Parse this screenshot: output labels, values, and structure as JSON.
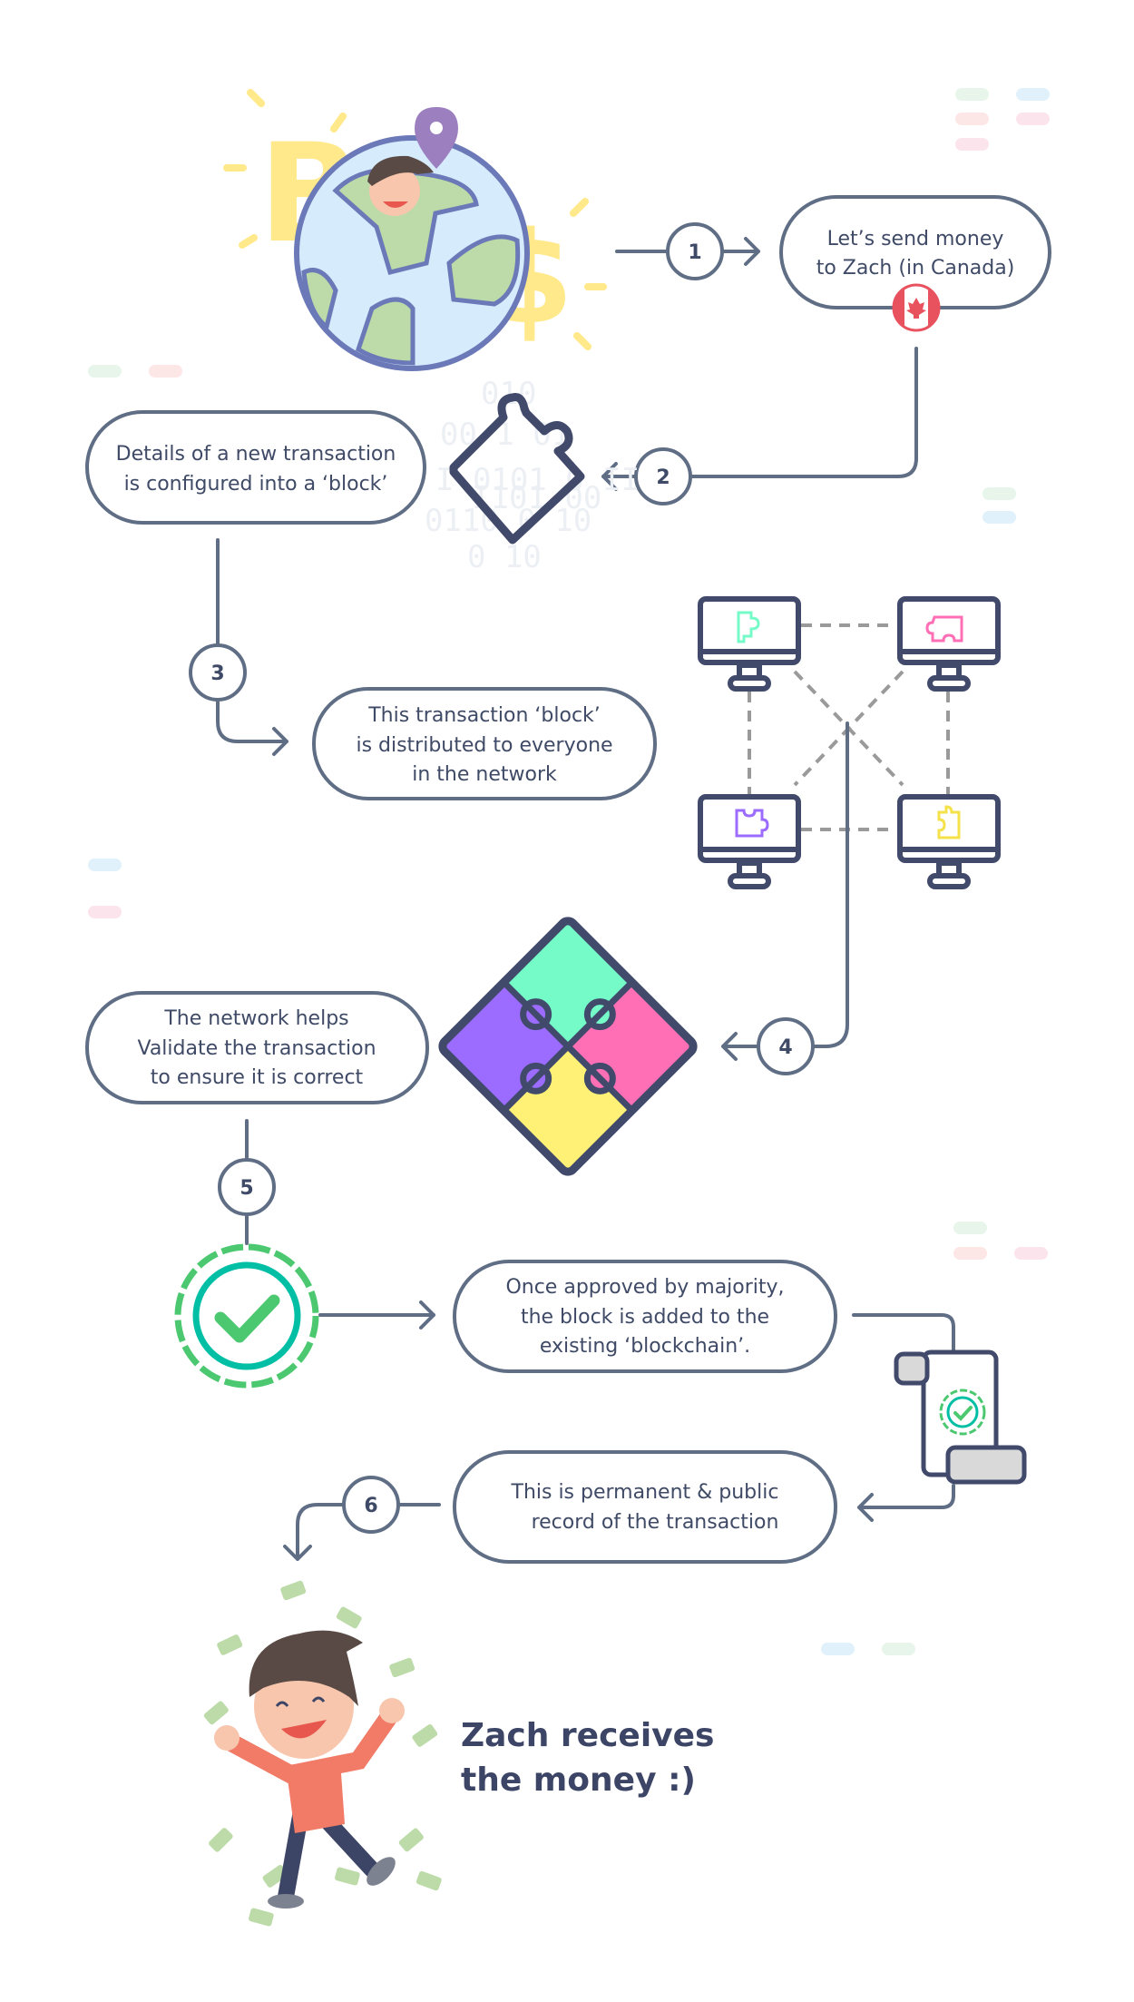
{
  "steps": [
    "1",
    "2",
    "3",
    "4",
    "5",
    "6"
  ],
  "boxes": {
    "send": [
      "Let’s send money",
      "to Zach (in Canada)"
    ],
    "block": [
      "Details of a new transaction",
      "is configured into a ‘block’"
    ],
    "distributed": [
      "This transaction ‘block’",
      "is distributed to everyone",
      "in the network"
    ],
    "validate": [
      "The network helps",
      "Validate the transaction",
      "to ensure it is correct"
    ],
    "approved": [
      "Once approved by majority,",
      "the block is added to the",
      "existing ‘blockchain’."
    ],
    "permanent": [
      "This is permanent & public",
      "record of the transaction"
    ]
  },
  "final": [
    "Zach receives",
    "the money :)"
  ],
  "binary": [
    "010",
    "00 1 01",
    "I 0101 0 II",
    "I101 00",
    "0110 0 10",
    "0 10"
  ],
  "icons": [
    "globe-with-bitcoin-dollar",
    "map-pin",
    "canada-flag",
    "puzzle-piece",
    "network-monitors",
    "four-piece-puzzle",
    "approval-badge-check",
    "certificate-scroll",
    "happy-man-with-money"
  ],
  "colors": {
    "outline": "#5f6e85",
    "text": "#3f4a66",
    "mint": "#74fbc8",
    "pink": "#ff6fb5",
    "yellow": "#fff176",
    "purple": "#9b6cff",
    "green": "#4cc870",
    "teal": "#00bfa5"
  }
}
